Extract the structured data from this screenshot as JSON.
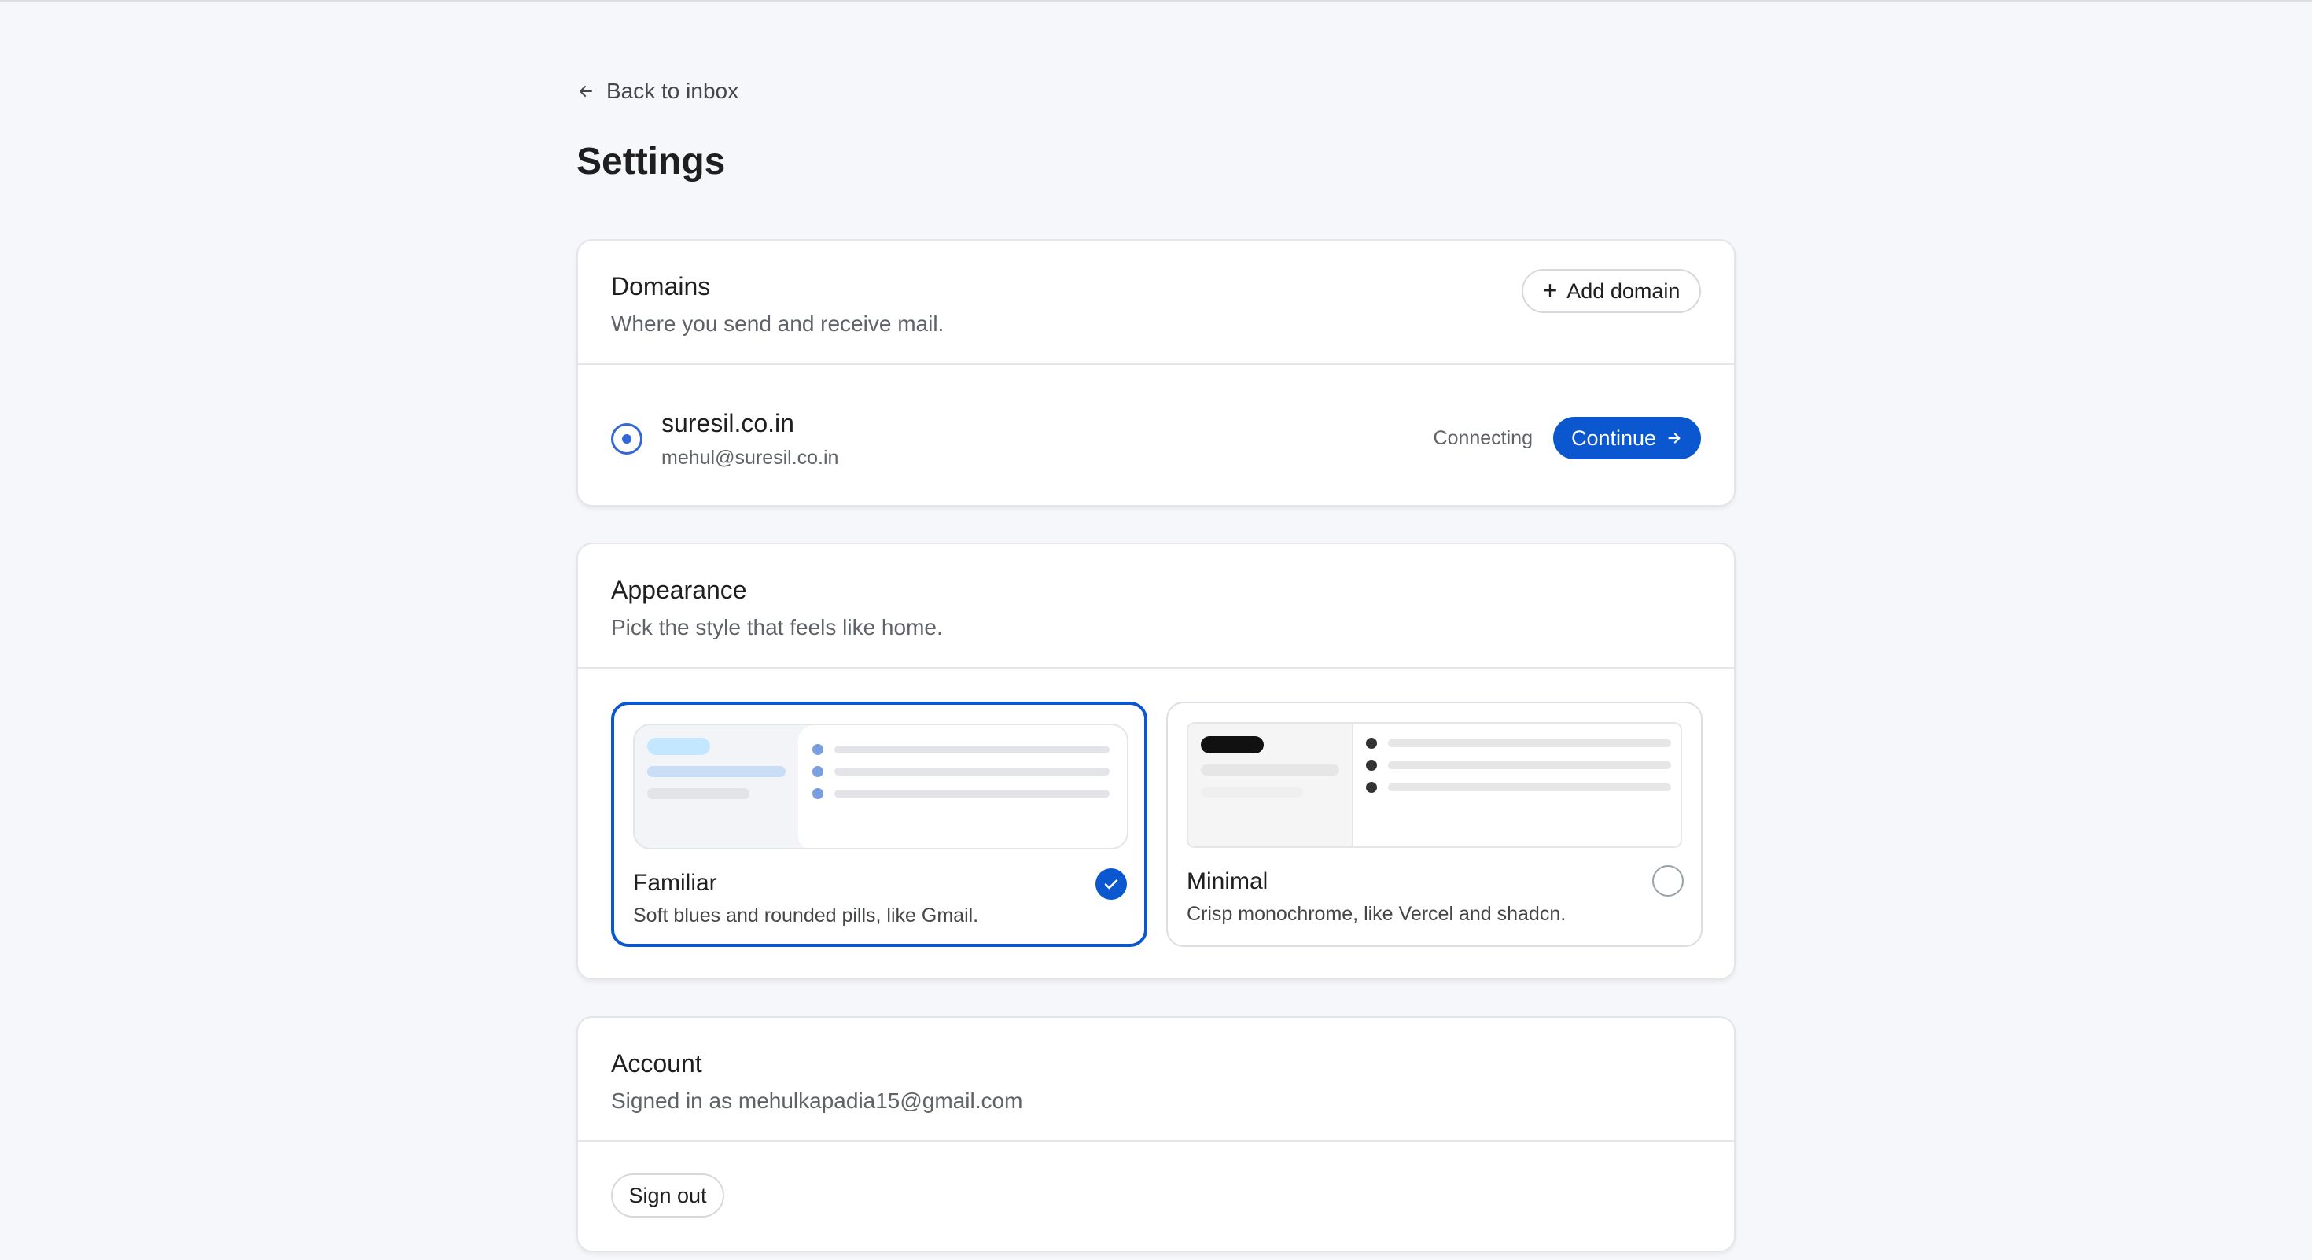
{
  "nav": {
    "back_label": "Back to inbox"
  },
  "page": {
    "title": "Settings"
  },
  "domains": {
    "title": "Domains",
    "subtitle": "Where you send and receive mail.",
    "add_label": "Add domain",
    "items": [
      {
        "name": "suresil.co.in",
        "email": "mehul@suresil.co.in",
        "status": "Connecting",
        "action_label": "Continue"
      }
    ]
  },
  "appearance": {
    "title": "Appearance",
    "subtitle": "Pick the style that feels like home.",
    "options": [
      {
        "name": "Familiar",
        "description": "Soft blues and rounded pills, like Gmail.",
        "selected": true
      },
      {
        "name": "Minimal",
        "description": "Crisp monochrome, like Vercel and shadcn.",
        "selected": false
      }
    ]
  },
  "account": {
    "title": "Account",
    "subtitle": "Signed in as mehulkapadia15@gmail.com",
    "sign_out_label": "Sign out"
  },
  "colors": {
    "accent": "#0b57d0",
    "radio_accent": "#3367d6",
    "background": "#f6f7fa"
  },
  "icons": [
    "arrow-left-icon",
    "plus-icon",
    "radio-selected-icon",
    "arrow-right-icon",
    "check-circle-icon",
    "radio-empty-icon"
  ]
}
